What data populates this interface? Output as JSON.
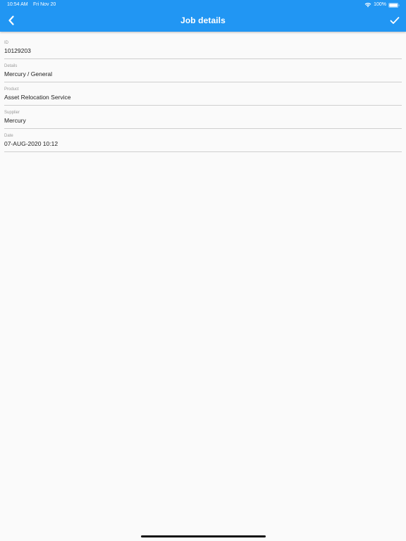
{
  "status_bar": {
    "time": "10:54 AM",
    "date": "Fri Nov 20",
    "battery_text": "100%",
    "icons": [
      "wifi-icon",
      "battery-icon"
    ]
  },
  "app_bar": {
    "title": "Job details",
    "back_icon": "chevron-left-icon",
    "confirm_icon": "check-icon",
    "color": "#2196f3"
  },
  "fields": [
    {
      "label": "ID",
      "value": "10129203"
    },
    {
      "label": "Details",
      "value": "Mercury / General"
    },
    {
      "label": "Product",
      "value": "Asset Relocation Service"
    },
    {
      "label": "Supplier",
      "value": "Mercury"
    },
    {
      "label": "Date",
      "value": "07-AUG-2020 10:12"
    }
  ]
}
